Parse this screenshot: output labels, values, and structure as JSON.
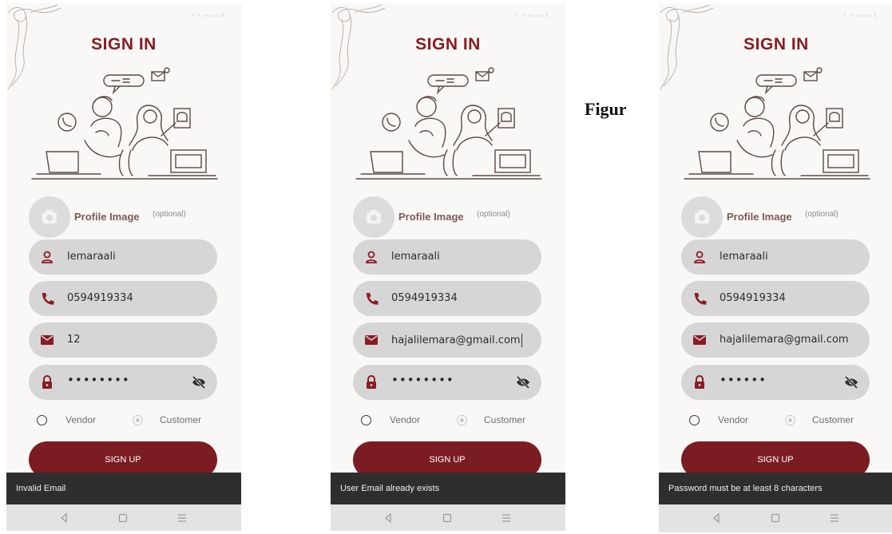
{
  "figure_label": "Figur",
  "colors": {
    "brand": "#8a1c23",
    "button": "#7b1c22",
    "field": "#d6d6d6",
    "toast": "#2e2e2e",
    "navbar": "#e3e3e3"
  },
  "screens": [
    {
      "title": "SIGN IN",
      "profile": {
        "label": "Profile Image",
        "optional": "(optional)",
        "icon": "camera-icon"
      },
      "fields": {
        "username": "lemaraali",
        "phone": "0594919334",
        "email": "12",
        "password": "••••••••"
      },
      "roles": {
        "vendor": "Vendor",
        "customer": "Customer",
        "selected": "Customer"
      },
      "button": "SIGN UP",
      "toast": "Invalid Email"
    },
    {
      "title": "SIGN IN",
      "profile": {
        "label": "Profile Image",
        "optional": "(optional)",
        "icon": "camera-icon"
      },
      "fields": {
        "username": "lemaraali",
        "phone": "0594919334",
        "email": "hajalilemara@gmail.com",
        "password": "••••••••"
      },
      "roles": {
        "vendor": "Vendor",
        "customer": "Customer",
        "selected": "Customer"
      },
      "button": "SIGN UP",
      "toast": "User Email already exists"
    },
    {
      "title": "SIGN IN",
      "profile": {
        "label": "Profile Image",
        "optional": "(optional)",
        "icon": "camera-icon"
      },
      "fields": {
        "username": "lemaraali",
        "phone": "0594919334",
        "email": "hajalilemara@gmail.com",
        "password": "••••••"
      },
      "roles": {
        "vendor": "Vendor",
        "customer": "Customer",
        "selected": "Customer"
      },
      "button": "SIGN UP",
      "toast": "Password must be at least 8 characters"
    }
  ]
}
